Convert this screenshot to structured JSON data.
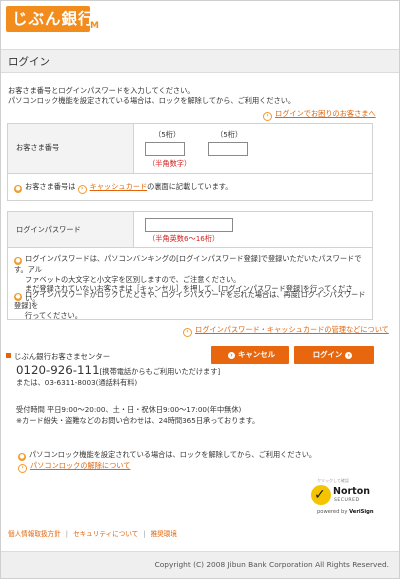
{
  "bank": {
    "name": "じぶん銀行",
    "mark": "M"
  },
  "page_title": "ログイン",
  "intro": {
    "line1": "お客さま番号とログインパスワードを入力してください。",
    "line2": "パソコンロック機能を設定されている場合は、ロックを解除してから、ご利用ください。"
  },
  "help_link_login": "ログインでお困りのお客さまへ",
  "customer_number": {
    "label": "お客さま番号",
    "hint_a": "（5桁）",
    "hint_b": "（5桁）",
    "value_a": "",
    "value_b": "",
    "rule": "（半角数字）",
    "note_prefix": "お客さま番号は",
    "note_link": "キャッシュカード",
    "note_suffix": "の裏面に記載しています。"
  },
  "password": {
    "label": "ログインパスワード",
    "value": "",
    "rule": "（半角英数6〜16桁）",
    "note1_line1": "ログインパスワードは、パソコンバンキングの[ログインパスワード登録]で登録いただいたパスワードです。アル",
    "note1_line2": "ファベットの大文字と小文字を区別しますので、ご注意ください。",
    "note1_line3": "まだ登録されていないお客さまは［キャンセル］を押して、[ログインパスワード登録]を行ってください。",
    "note2_line1": "ログインパスワードがロックしたときや、ログインパスワードを忘れた場合は、再度[ログインパスワード登録]を",
    "note2_line2": "行ってください。"
  },
  "help_link_manage": "ログインパスワード・キャッシュカードの管理などについて",
  "support": {
    "title": "じぶん銀行お客さまセンター",
    "tel": "0120-926-111",
    "tel_note": "[携帯電話からもご利用いただけます]",
    "tel_alt": "または、03-6311-8003(通話料有料)",
    "hours": "受付時間 平日9:00〜20:00、土・日・祝休日9:00〜17:00(年中無休)",
    "hours_note": "※カード紛失・盗難などのお問い合わせは、24時間365日承っております。"
  },
  "buttons": {
    "cancel": "キャンセル",
    "login": "ログイン"
  },
  "lock": {
    "text": "パソコンロック機能を設定されている場合は、ロックを解除してから、ご利用ください。",
    "link": "パソコンロックの解除について"
  },
  "norton": {
    "top": "クリックして確認",
    "name": "Norton",
    "secured": "SECURED",
    "powered": "powered by ",
    "verisign": "VeriSign"
  },
  "footer": {
    "links": [
      "個人情報取扱方針",
      "セキュリティについて",
      "推奨環境"
    ],
    "copyright": "Copyright (C) 2008 Jibun Bank Corporation All Rights Reserved."
  },
  "colors": {
    "accent": "#e8660e",
    "brand": "#f28c1c",
    "warning": "#d11f1f"
  }
}
